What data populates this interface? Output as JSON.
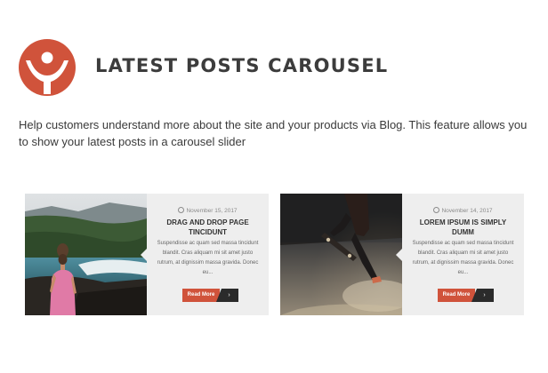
{
  "header": {
    "logo_icon": "person-circle-logo-icon",
    "title": "LATEST POSTS CAROUSEL",
    "accent_color": "#d0533b"
  },
  "description": "Help customers understand more about the site and your products via Blog. This feature allows you to show your latest posts in a carousel slider",
  "posts": [
    {
      "date": "November 15, 2017",
      "title": "DRAG AND DROP PAGE TINCIDUNT",
      "excerpt": "Suspendisse ac quam sed massa tincidunt blandit. Cras aliquam mi sit amet justo rutrum, at dignissim massa gravida. Donec eu...",
      "button_label": "Read More",
      "image": "woman-on-rocky-coast-photo"
    },
    {
      "date": "November 14, 2017",
      "title": "LOREM IPSUM IS SIMPLY DUMM",
      "excerpt": "Suspendisse ac quam sed massa tincidunt blandit. Cras aliquam mi sit amet justo rutrum, at dignissim massa gravida. Donec eu...",
      "button_label": "Read More",
      "image": "skateboarder-jumping-photo"
    }
  ]
}
